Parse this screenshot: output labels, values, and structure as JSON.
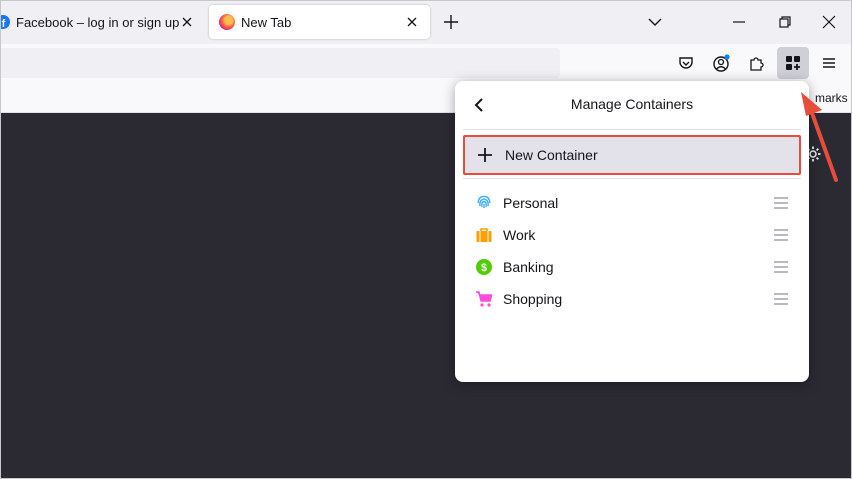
{
  "tabs": [
    {
      "label": "Facebook – log in or sign up",
      "icon": "facebook-icon"
    },
    {
      "label": "New Tab",
      "icon": "firefox-icon"
    }
  ],
  "bookmarks": {
    "partial_label": "marks"
  },
  "panel": {
    "title": "Manage Containers",
    "new_container_label": "New Container",
    "containers": [
      {
        "label": "Personal",
        "icon": "fingerprint-icon",
        "color": "#37adff"
      },
      {
        "label": "Work",
        "icon": "briefcase-icon",
        "color": "#ff9f00"
      },
      {
        "label": "Banking",
        "icon": "dollar-icon",
        "color": "#51cd00"
      },
      {
        "label": "Shopping",
        "icon": "cart-icon",
        "color": "#ff4bda"
      }
    ]
  },
  "colors": {
    "highlight": "#e74c3c",
    "accent": "#0a84ff"
  }
}
